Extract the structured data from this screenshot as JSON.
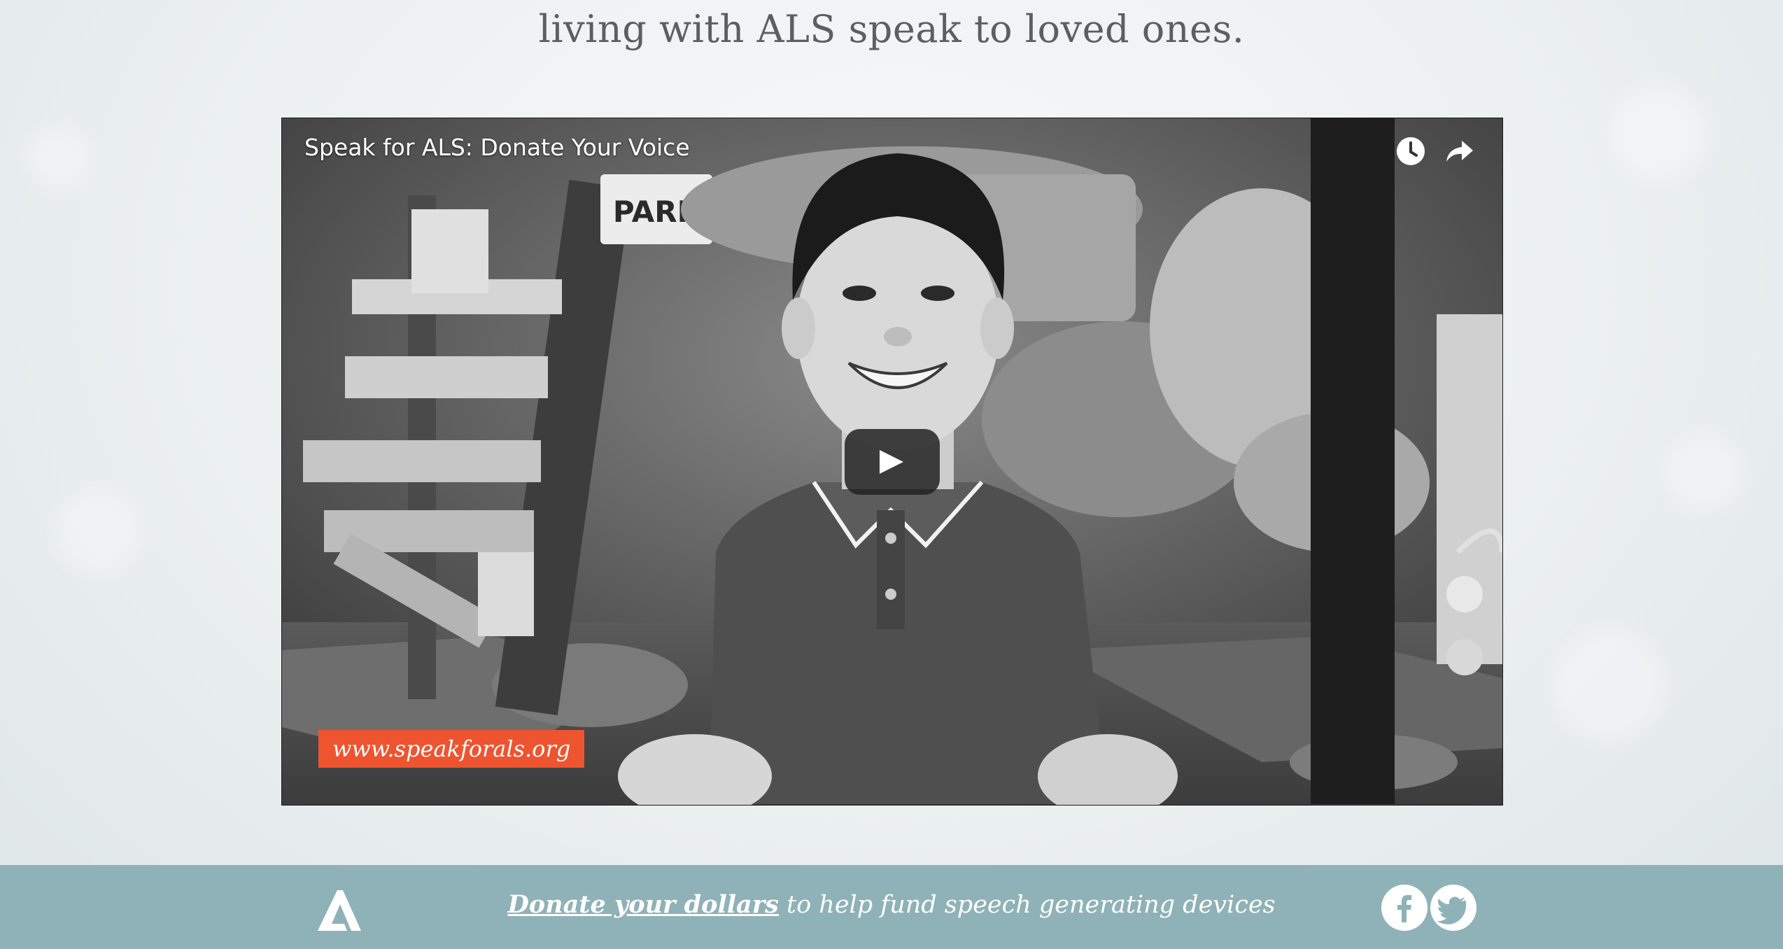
{
  "headline": "living with ALS speak to loved ones.",
  "video": {
    "title": "Speak for ALS: Donate Your Voice",
    "badge_text": "www.speakforals.org",
    "sign_text": "PARK",
    "icons": [
      "clock-icon",
      "share-icon",
      "play-icon"
    ]
  },
  "footer": {
    "link_text": "Donate your dollars",
    "text": " to help fund speech generating devices",
    "social": [
      "facebook-icon",
      "twitter-icon"
    ]
  },
  "colors": {
    "footer_bg": "#8fb2b8",
    "badge_bg": "#ee5430",
    "headline": "#5a5f62"
  }
}
